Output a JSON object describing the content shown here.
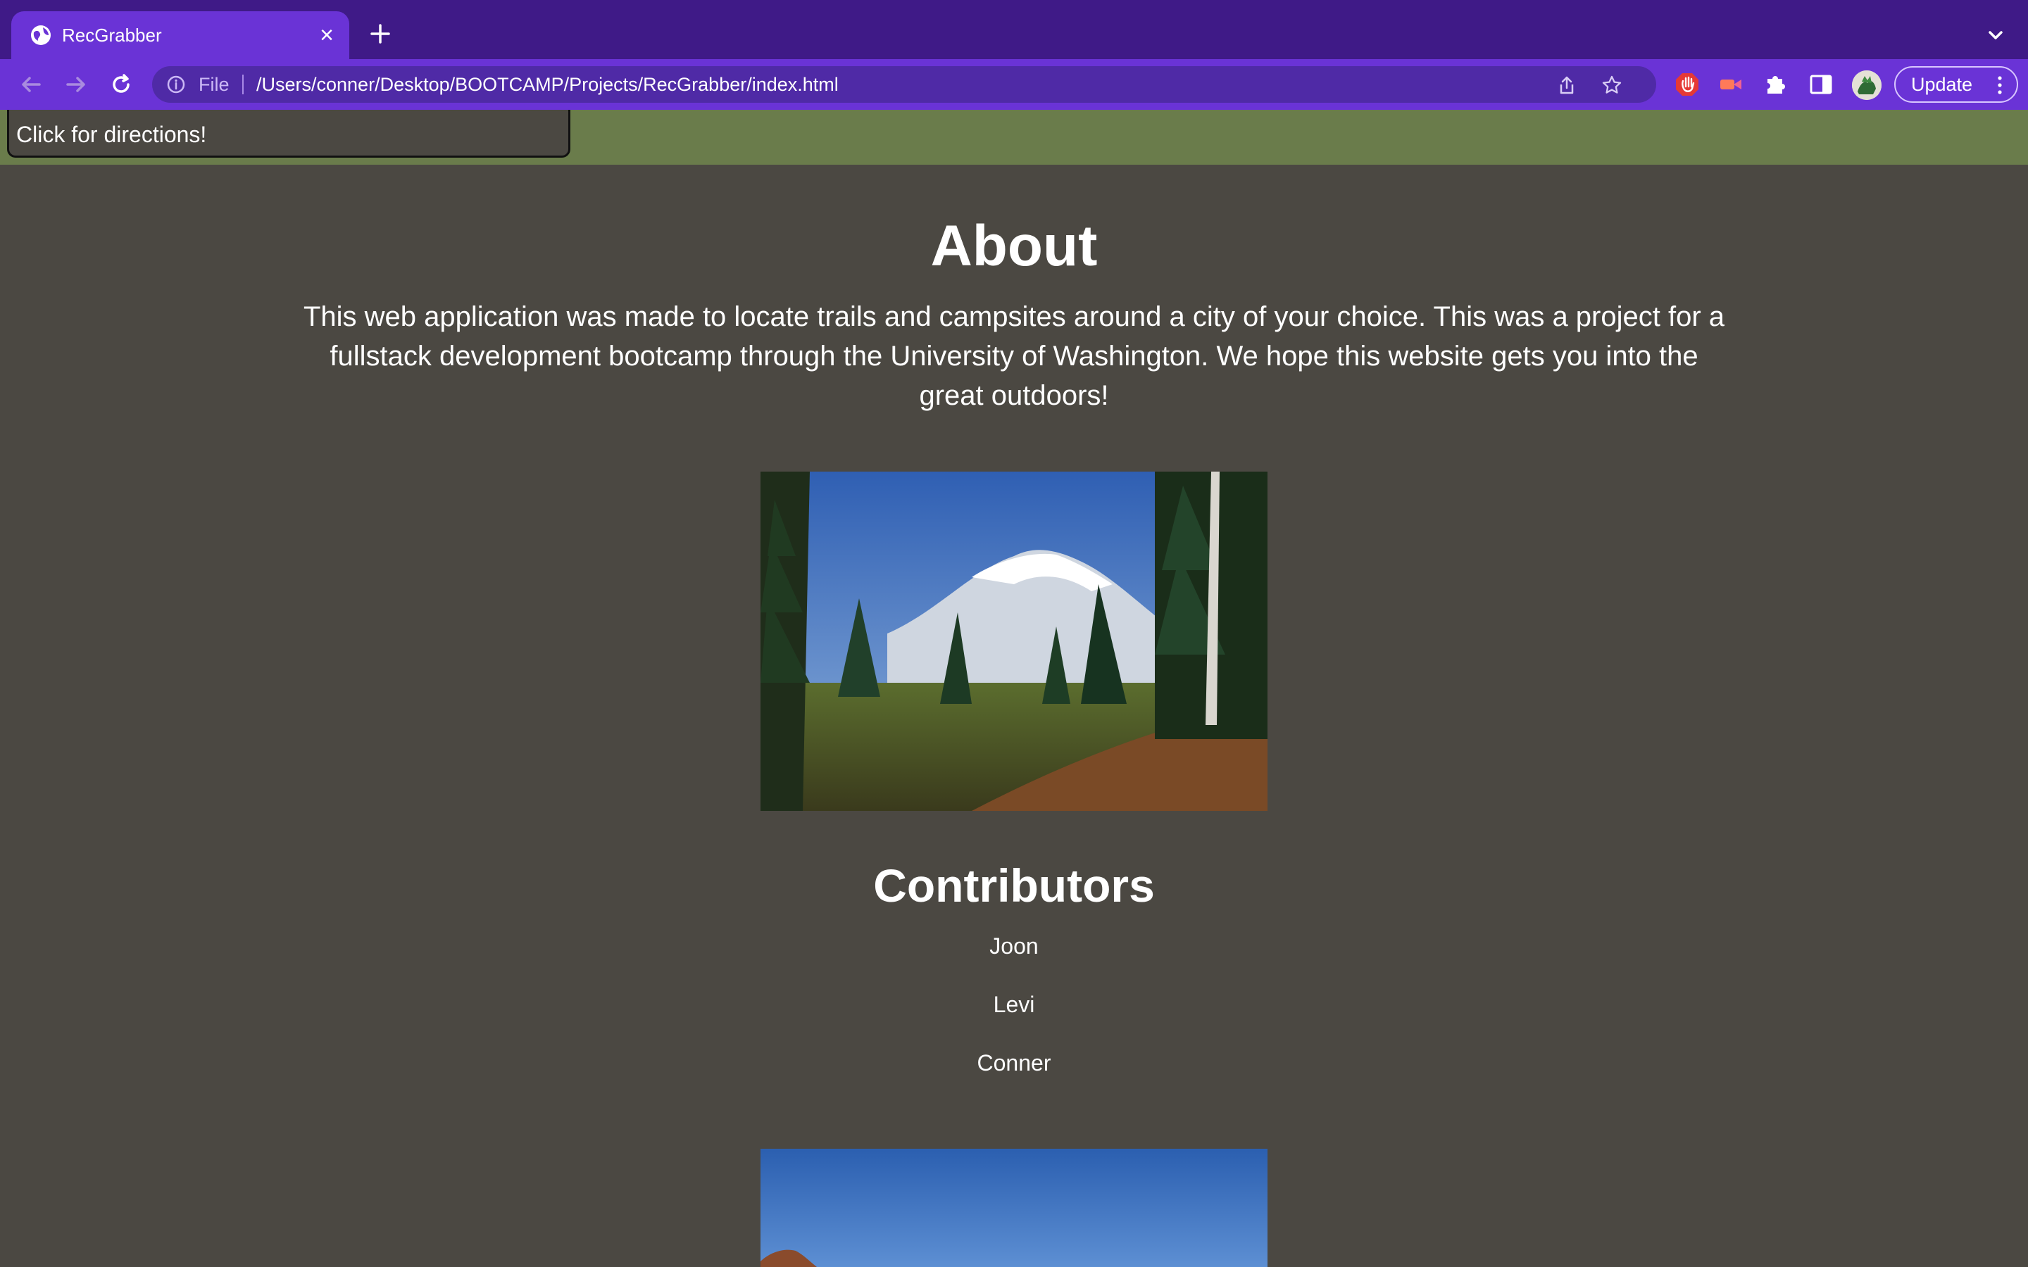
{
  "browser": {
    "tab_title": "RecGrabber",
    "omnibox": {
      "scheme_label": "File",
      "url": "/Users/conner/Desktop/BOOTCAMP/Projects/RecGrabber/index.html"
    },
    "update_label": "Update",
    "accent_color": "#6a33d6",
    "tabstrip_color": "#3f1a87"
  },
  "page": {
    "directions_label": "Click for directions!",
    "header_color": "#6a7c4b",
    "background_color": "#4b4842",
    "about": {
      "title": "About",
      "text": "This web application was made to locate trails and campsites around a city of your choice. This was a project for a fullstack development bootcamp through the University of Washington. We hope this website gets you into the great outdoors!"
    },
    "contributors": {
      "title": "Contributors",
      "names": [
        "Joon",
        "Levi",
        "Conner"
      ]
    }
  }
}
